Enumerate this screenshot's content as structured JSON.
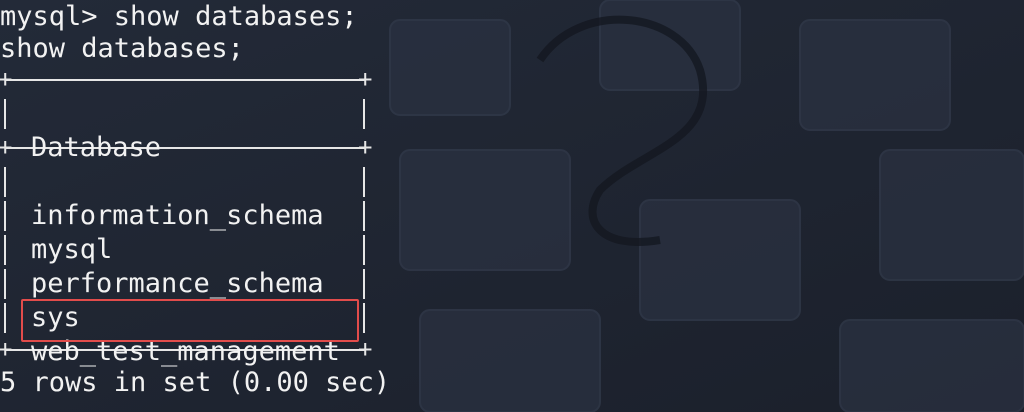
{
  "terminal": {
    "prompt_line": "mysql> show databases;",
    "echo_line": "show databases;",
    "table": {
      "header": "Database",
      "rows": [
        "information_schema",
        "mysql",
        "performance_schema",
        "sys",
        "web_test_management"
      ],
      "highlighted_row": "web_test_management"
    },
    "footer": "5 rows in set (0.00 sec)"
  },
  "colors": {
    "background": "#1f2533",
    "text": "#f2f2f2",
    "highlight": "#e24c4b"
  }
}
